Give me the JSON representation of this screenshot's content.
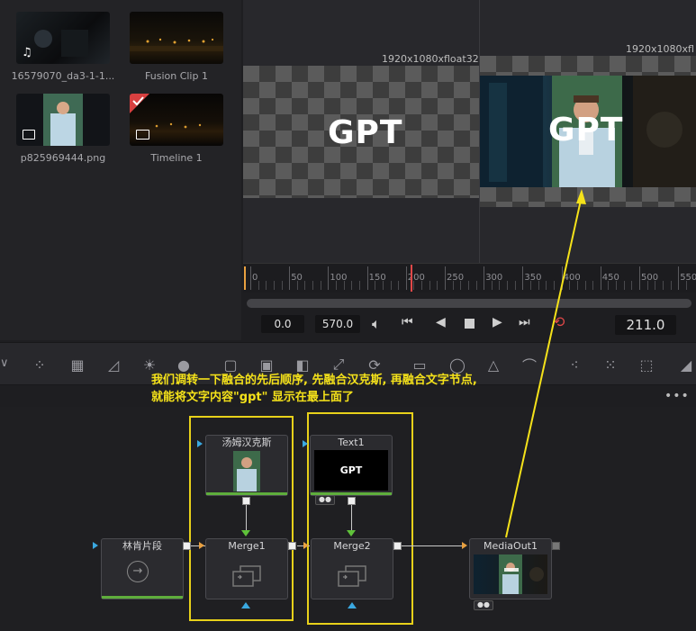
{
  "media_pool": {
    "clips": [
      {
        "name": "16579070_da3-1-1...",
        "badge": "music-note-icon"
      },
      {
        "name": "Fusion Clip 1",
        "badge": ""
      },
      {
        "name": "p825969444.png",
        "badge": "image-icon"
      },
      {
        "name": "Timeline 1",
        "badge": "timeline-icon"
      }
    ]
  },
  "viewers": {
    "left": {
      "resolution": "1920x1080xfloat32",
      "text": "GPT"
    },
    "right": {
      "resolution": "1920x1080xfl",
      "text": "GPT"
    }
  },
  "ruler": {
    "ticks": [
      "0",
      "50",
      "100",
      "150",
      "200",
      "250",
      "300",
      "350",
      "400",
      "450",
      "500",
      "550"
    ],
    "playhead_value": 211
  },
  "transport": {
    "start": "0.0",
    "end": "570.0",
    "current": "211.0"
  },
  "annotation": {
    "line1": "我们调转一下融合的先后顺序, 先融合汉克斯, 再融合文字节点,",
    "line2": "就能将文字内容\"gpt\" 显示在最上面了",
    "color": "#f5e21a"
  },
  "nodes": {
    "mediain": {
      "title": "林肯片段"
    },
    "hanks": {
      "title": "汤姆汉克斯"
    },
    "text1": {
      "title": "Text1",
      "preview_text": "GPT"
    },
    "merge1": {
      "title": "Merge1"
    },
    "merge2": {
      "title": "Merge2"
    },
    "mediaout": {
      "title": "MediaOut1"
    }
  },
  "colors": {
    "accent_orange": "#e8a040",
    "selection_yellow": "#e8d11a",
    "playhead_red": "#e04848",
    "port_blue": "#3aa8e0",
    "port_green": "#5fc23a"
  }
}
